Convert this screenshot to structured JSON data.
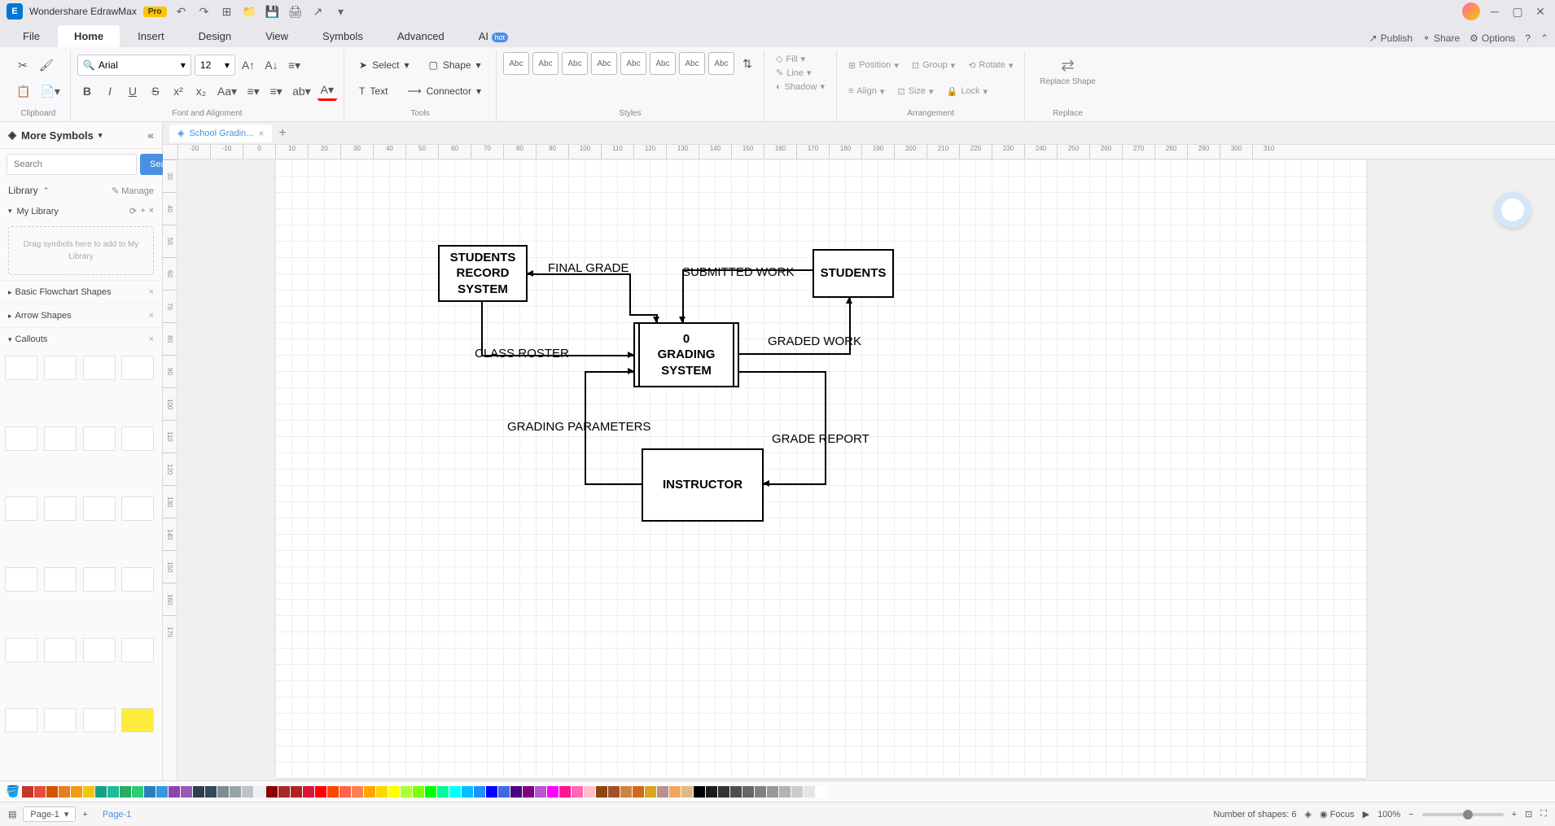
{
  "app": {
    "title": "Wondershare EdrawMax",
    "badge": "Pro"
  },
  "menu": {
    "tabs": [
      "File",
      "Home",
      "Insert",
      "Design",
      "View",
      "Symbols",
      "Advanced",
      "AI"
    ],
    "active": 1,
    "hot": "hot",
    "right": {
      "publish": "Publish",
      "share": "Share",
      "options": "Options"
    }
  },
  "ribbon": {
    "clipboard_label": "Clipboard",
    "font": {
      "name": "Arial",
      "size": "12"
    },
    "font_label": "Font and Alignment",
    "select": "Select",
    "text": "Text",
    "shape": "Shape",
    "connector": "Connector",
    "tools_label": "Tools",
    "style_abc": "Abc",
    "styles_label": "Styles",
    "props": {
      "fill": "Fill",
      "line": "Line",
      "shadow": "Shadow"
    },
    "arrange": {
      "position": "Position",
      "align": "Align",
      "group": "Group",
      "size": "Size",
      "rotate": "Rotate",
      "lock": "Lock"
    },
    "arrange_label": "Arrangement",
    "replace_shape": "Replace Shape",
    "replace_label": "Replace"
  },
  "sidebar": {
    "title": "More Symbols",
    "search_btn": "Search",
    "search_ph": "Search",
    "library": "Library",
    "manage": "Manage",
    "mylib": "My Library",
    "dropzone": "Drag symbols here to add to My Library",
    "sections": [
      "Basic Flowchart Shapes",
      "Arrow Shapes",
      "Callouts"
    ]
  },
  "doc": {
    "tab": "School Gradin...",
    "page_tab": "Page-1"
  },
  "ruler": {
    "h": [
      "-20",
      "-10",
      "0",
      "10",
      "20",
      "30",
      "40",
      "50",
      "60",
      "70",
      "80",
      "90",
      "100",
      "110",
      "120",
      "130",
      "140",
      "150",
      "160",
      "170",
      "180",
      "190",
      "200",
      "210",
      "220",
      "230",
      "240",
      "250",
      "260",
      "270",
      "280",
      "290",
      "300",
      "310"
    ],
    "v": [
      "30",
      "40",
      "50",
      "60",
      "70",
      "80",
      "90",
      "100",
      "110",
      "120",
      "130",
      "140",
      "150",
      "160",
      "170"
    ]
  },
  "diagram": {
    "students_record": "STUDENTS RECORD SYSTEM",
    "students": "STUDENTS",
    "grading_system_num": "0",
    "grading_system": "GRADING SYSTEM",
    "instructor": "INSTRUCTOR",
    "final_grade": "FINAL GRADE",
    "submitted_work": "SUBMITTED WORK",
    "class_roster": "CLASS ROSTER",
    "graded_work": "GRADED WORK",
    "grading_params": "GRADING PARAMETERS",
    "grade_report": "GRADE REPORT"
  },
  "status": {
    "page_sel": "Page-1",
    "page_tab": "Page-1",
    "shapes": "Number of shapes: 6",
    "focus": "Focus",
    "zoom": "100%"
  },
  "colors": [
    "#c0392b",
    "#e74c3c",
    "#d35400",
    "#e67e22",
    "#f39c12",
    "#f1c40f",
    "#16a085",
    "#1abc9c",
    "#27ae60",
    "#2ecc71",
    "#2980b9",
    "#3498db",
    "#8e44ad",
    "#9b59b6",
    "#2c3e50",
    "#34495e",
    "#7f8c8d",
    "#95a5a6",
    "#bdc3c7",
    "#ecf0f1",
    "#8b0000",
    "#a52a2a",
    "#b22222",
    "#dc143c",
    "#ff0000",
    "#ff4500",
    "#ff6347",
    "#ff7f50",
    "#ffa500",
    "#ffd700",
    "#ffff00",
    "#adff2f",
    "#7fff00",
    "#00ff00",
    "#00fa9a",
    "#00ffff",
    "#00bfff",
    "#1e90ff",
    "#0000ff",
    "#4169e1",
    "#4b0082",
    "#800080",
    "#ba55d3",
    "#ff00ff",
    "#ff1493",
    "#ff69b4",
    "#ffc0cb",
    "#8b4513",
    "#a0522d",
    "#cd853f",
    "#d2691e",
    "#daa520",
    "#bc8f8f",
    "#f4a460",
    "#deb887",
    "#000000",
    "#1a1a1a",
    "#333333",
    "#4d4d4d",
    "#666666",
    "#808080",
    "#999999",
    "#b3b3b3",
    "#cccccc",
    "#e6e6e6",
    "#ffffff"
  ]
}
